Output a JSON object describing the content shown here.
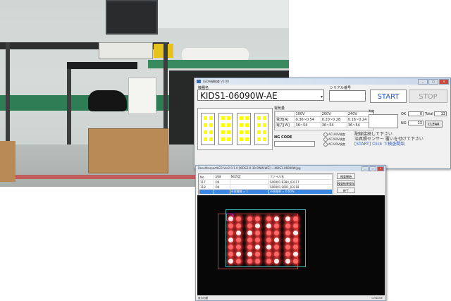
{
  "app": {
    "title": "LED外観検査 V1.00",
    "labels": {
      "model": "機種名",
      "serial": "シリアル番号",
      "measured": "電気量",
      "judge": "判定",
      "ng_code": "NG CODE"
    },
    "model_value": "KIDS1-06090W-AE",
    "buttons": {
      "start": "START",
      "stop": "STOP",
      "clear": "CLEAR"
    },
    "measurement": {
      "headers": [
        "",
        "100V",
        "200V",
        "240V"
      ],
      "rows": [
        [
          "電流[A]",
          "0.36~0.54",
          "0.20~0.28",
          "0.16~0.24"
        ],
        [
          "電力[W]",
          "36~54",
          "36~54",
          "36~54"
        ]
      ]
    },
    "radio": [
      "AC100V検査",
      "AC200V検査",
      "AC240V検査"
    ],
    "counts": {
      "ok_label": "OK",
      "ok": "0",
      "total_label": "Total",
      "total": "13",
      "ng_label": "NG",
      "ng": "13"
    },
    "messages": [
      "配線接続して下さい",
      "治具照センサー 覆いを付けて下さい",
      "[START] Click で検査開始"
    ]
  },
  "viewer": {
    "title": "ResultInspectLED Ver2.0.1.0 [KIDS2-0.39 0WW-WE] → KIDS1-06090W.jpg",
    "columns": [
      "No",
      "記録",
      "NG判定",
      "ファイル名"
    ],
    "rows": [
      [
        "117",
        "OK",
        "",
        "S00001 B384_03117"
      ],
      [
        "118",
        "OK",
        "",
        "S00001 S001_03118"
      ],
      [
        "",
        "",
        "不合格数 = 1",
        "不合格率 = 0.00%"
      ]
    ],
    "buttons": [
      "検査開始",
      "検査結果保存",
      "終了"
    ],
    "status_left": "表示切替",
    "status_right": "CONLINE"
  },
  "colors": {
    "start_text": "#1a55d6",
    "stop_text": "#9a9a9a",
    "led_glow": "#ff3b3b",
    "chip_yellow": "#ffff00"
  }
}
